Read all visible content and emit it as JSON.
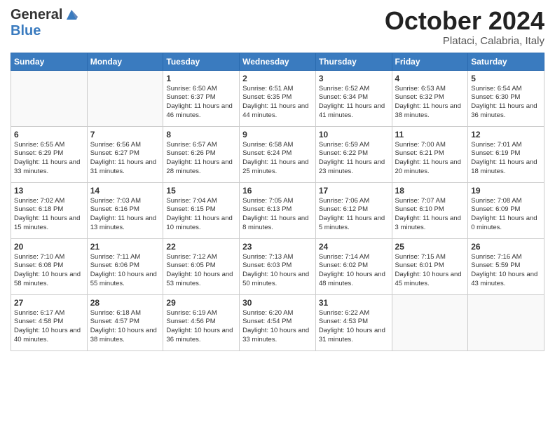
{
  "header": {
    "logo": {
      "general": "General",
      "blue": "Blue"
    },
    "title": "October 2024",
    "location": "Plataci, Calabria, Italy"
  },
  "weekdays": [
    "Sunday",
    "Monday",
    "Tuesday",
    "Wednesday",
    "Thursday",
    "Friday",
    "Saturday"
  ],
  "weeks": [
    [
      {
        "day": "",
        "sunrise": "",
        "sunset": "",
        "daylight": ""
      },
      {
        "day": "",
        "sunrise": "",
        "sunset": "",
        "daylight": ""
      },
      {
        "day": "1",
        "sunrise": "Sunrise: 6:50 AM",
        "sunset": "Sunset: 6:37 PM",
        "daylight": "Daylight: 11 hours and 46 minutes."
      },
      {
        "day": "2",
        "sunrise": "Sunrise: 6:51 AM",
        "sunset": "Sunset: 6:35 PM",
        "daylight": "Daylight: 11 hours and 44 minutes."
      },
      {
        "day": "3",
        "sunrise": "Sunrise: 6:52 AM",
        "sunset": "Sunset: 6:34 PM",
        "daylight": "Daylight: 11 hours and 41 minutes."
      },
      {
        "day": "4",
        "sunrise": "Sunrise: 6:53 AM",
        "sunset": "Sunset: 6:32 PM",
        "daylight": "Daylight: 11 hours and 38 minutes."
      },
      {
        "day": "5",
        "sunrise": "Sunrise: 6:54 AM",
        "sunset": "Sunset: 6:30 PM",
        "daylight": "Daylight: 11 hours and 36 minutes."
      }
    ],
    [
      {
        "day": "6",
        "sunrise": "Sunrise: 6:55 AM",
        "sunset": "Sunset: 6:29 PM",
        "daylight": "Daylight: 11 hours and 33 minutes."
      },
      {
        "day": "7",
        "sunrise": "Sunrise: 6:56 AM",
        "sunset": "Sunset: 6:27 PM",
        "daylight": "Daylight: 11 hours and 31 minutes."
      },
      {
        "day": "8",
        "sunrise": "Sunrise: 6:57 AM",
        "sunset": "Sunset: 6:26 PM",
        "daylight": "Daylight: 11 hours and 28 minutes."
      },
      {
        "day": "9",
        "sunrise": "Sunrise: 6:58 AM",
        "sunset": "Sunset: 6:24 PM",
        "daylight": "Daylight: 11 hours and 25 minutes."
      },
      {
        "day": "10",
        "sunrise": "Sunrise: 6:59 AM",
        "sunset": "Sunset: 6:22 PM",
        "daylight": "Daylight: 11 hours and 23 minutes."
      },
      {
        "day": "11",
        "sunrise": "Sunrise: 7:00 AM",
        "sunset": "Sunset: 6:21 PM",
        "daylight": "Daylight: 11 hours and 20 minutes."
      },
      {
        "day": "12",
        "sunrise": "Sunrise: 7:01 AM",
        "sunset": "Sunset: 6:19 PM",
        "daylight": "Daylight: 11 hours and 18 minutes."
      }
    ],
    [
      {
        "day": "13",
        "sunrise": "Sunrise: 7:02 AM",
        "sunset": "Sunset: 6:18 PM",
        "daylight": "Daylight: 11 hours and 15 minutes."
      },
      {
        "day": "14",
        "sunrise": "Sunrise: 7:03 AM",
        "sunset": "Sunset: 6:16 PM",
        "daylight": "Daylight: 11 hours and 13 minutes."
      },
      {
        "day": "15",
        "sunrise": "Sunrise: 7:04 AM",
        "sunset": "Sunset: 6:15 PM",
        "daylight": "Daylight: 11 hours and 10 minutes."
      },
      {
        "day": "16",
        "sunrise": "Sunrise: 7:05 AM",
        "sunset": "Sunset: 6:13 PM",
        "daylight": "Daylight: 11 hours and 8 minutes."
      },
      {
        "day": "17",
        "sunrise": "Sunrise: 7:06 AM",
        "sunset": "Sunset: 6:12 PM",
        "daylight": "Daylight: 11 hours and 5 minutes."
      },
      {
        "day": "18",
        "sunrise": "Sunrise: 7:07 AM",
        "sunset": "Sunset: 6:10 PM",
        "daylight": "Daylight: 11 hours and 3 minutes."
      },
      {
        "day": "19",
        "sunrise": "Sunrise: 7:08 AM",
        "sunset": "Sunset: 6:09 PM",
        "daylight": "Daylight: 11 hours and 0 minutes."
      }
    ],
    [
      {
        "day": "20",
        "sunrise": "Sunrise: 7:10 AM",
        "sunset": "Sunset: 6:08 PM",
        "daylight": "Daylight: 10 hours and 58 minutes."
      },
      {
        "day": "21",
        "sunrise": "Sunrise: 7:11 AM",
        "sunset": "Sunset: 6:06 PM",
        "daylight": "Daylight: 10 hours and 55 minutes."
      },
      {
        "day": "22",
        "sunrise": "Sunrise: 7:12 AM",
        "sunset": "Sunset: 6:05 PM",
        "daylight": "Daylight: 10 hours and 53 minutes."
      },
      {
        "day": "23",
        "sunrise": "Sunrise: 7:13 AM",
        "sunset": "Sunset: 6:03 PM",
        "daylight": "Daylight: 10 hours and 50 minutes."
      },
      {
        "day": "24",
        "sunrise": "Sunrise: 7:14 AM",
        "sunset": "Sunset: 6:02 PM",
        "daylight": "Daylight: 10 hours and 48 minutes."
      },
      {
        "day": "25",
        "sunrise": "Sunrise: 7:15 AM",
        "sunset": "Sunset: 6:01 PM",
        "daylight": "Daylight: 10 hours and 45 minutes."
      },
      {
        "day": "26",
        "sunrise": "Sunrise: 7:16 AM",
        "sunset": "Sunset: 5:59 PM",
        "daylight": "Daylight: 10 hours and 43 minutes."
      }
    ],
    [
      {
        "day": "27",
        "sunrise": "Sunrise: 6:17 AM",
        "sunset": "Sunset: 4:58 PM",
        "daylight": "Daylight: 10 hours and 40 minutes."
      },
      {
        "day": "28",
        "sunrise": "Sunrise: 6:18 AM",
        "sunset": "Sunset: 4:57 PM",
        "daylight": "Daylight: 10 hours and 38 minutes."
      },
      {
        "day": "29",
        "sunrise": "Sunrise: 6:19 AM",
        "sunset": "Sunset: 4:56 PM",
        "daylight": "Daylight: 10 hours and 36 minutes."
      },
      {
        "day": "30",
        "sunrise": "Sunrise: 6:20 AM",
        "sunset": "Sunset: 4:54 PM",
        "daylight": "Daylight: 10 hours and 33 minutes."
      },
      {
        "day": "31",
        "sunrise": "Sunrise: 6:22 AM",
        "sunset": "Sunset: 4:53 PM",
        "daylight": "Daylight: 10 hours and 31 minutes."
      },
      {
        "day": "",
        "sunrise": "",
        "sunset": "",
        "daylight": ""
      },
      {
        "day": "",
        "sunrise": "",
        "sunset": "",
        "daylight": ""
      }
    ]
  ]
}
